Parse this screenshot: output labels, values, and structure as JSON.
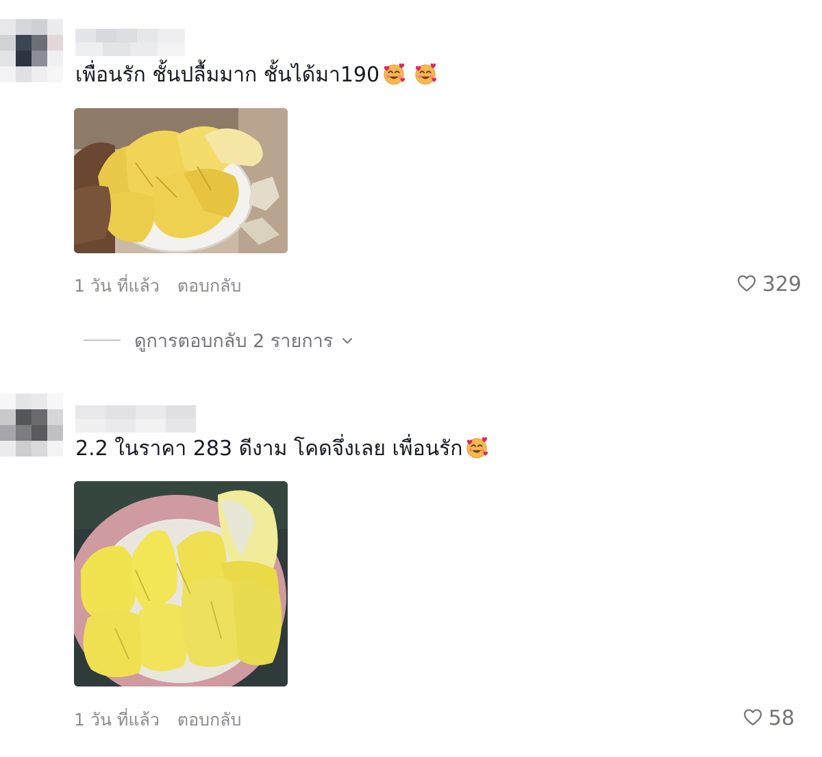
{
  "comments": [
    {
      "text": "เพื่อนรัก ชั้นปลื้มมาก ชั้นได้มา190",
      "time": "1 วัน ที่แล้ว",
      "reply_label": "ตอบกลับ",
      "likes": "329",
      "view_replies": "ดูการตอบกลับ 2 รายการ",
      "image": "durian-photo"
    },
    {
      "text": "2.2 ในราคา 283 ดีงาม โคดจึ่งเลย เพื่อนรัก",
      "time": "1 วัน ที่แล้ว",
      "reply_label": "ตอบกลับ",
      "likes": "58",
      "image": "durian-photo"
    }
  ],
  "icons": {
    "emoji": "smiling-face-with-hearts-icon",
    "like": "heart-outline-icon",
    "expand": "chevron-down-icon"
  },
  "colors": {
    "text": "#161823",
    "muted": "#8a8b91",
    "count": "#73747b"
  }
}
